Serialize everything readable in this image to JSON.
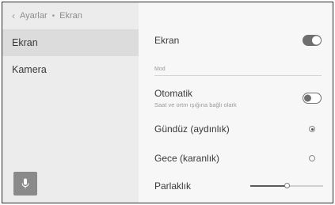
{
  "breadcrumb": {
    "back_icon": "chevron-left-icon",
    "parent": "Ayarlar",
    "separator": "•",
    "current": "Ekran"
  },
  "sidebar": {
    "items": [
      {
        "label": "Ekran",
        "active": true
      },
      {
        "label": "Kamera",
        "active": false
      }
    ],
    "mic_icon": "microphone-icon"
  },
  "settings": {
    "display_toggle": {
      "label": "Ekran",
      "on": true
    },
    "mode_section": "Mod",
    "auto_toggle": {
      "label": "Otomatik",
      "sublabel": "Saat ve ortm ışığına bağlı olark",
      "on": false
    },
    "day_option": {
      "label": "Gündüz (aydınlık)",
      "selected": true
    },
    "night_option": {
      "label": "Gece (karanlık)",
      "selected": false
    },
    "brightness": {
      "label": "Parlaklık",
      "value": 0.5
    }
  },
  "colors": {
    "toggle_active": "#6f6f6f",
    "sidebar_bg": "#ececec",
    "active_item_bg": "#dcdcdc"
  }
}
